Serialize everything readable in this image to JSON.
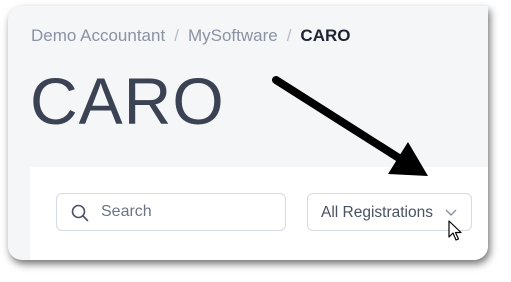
{
  "breadcrumb": {
    "items": [
      "Demo Accountant",
      "MySoftware"
    ],
    "separator": "/",
    "current": "CARO"
  },
  "page_title": "CARO",
  "filters": {
    "search_placeholder": "Search",
    "registration_select_value": "All Registrations"
  },
  "icons": {
    "search": "search-icon",
    "dropdown": "chevron-down-icon",
    "annotation": "arrow-pointer-icon",
    "cursor": "mouse-cursor-icon"
  },
  "colors": {
    "page_background": "#f5f6f8",
    "title": "#3a4254",
    "breadcrumb": "#8a93a3",
    "breadcrumb_current": "#1f2533",
    "input_border": "#d6dae1",
    "annotation_arrow": "#000000"
  }
}
